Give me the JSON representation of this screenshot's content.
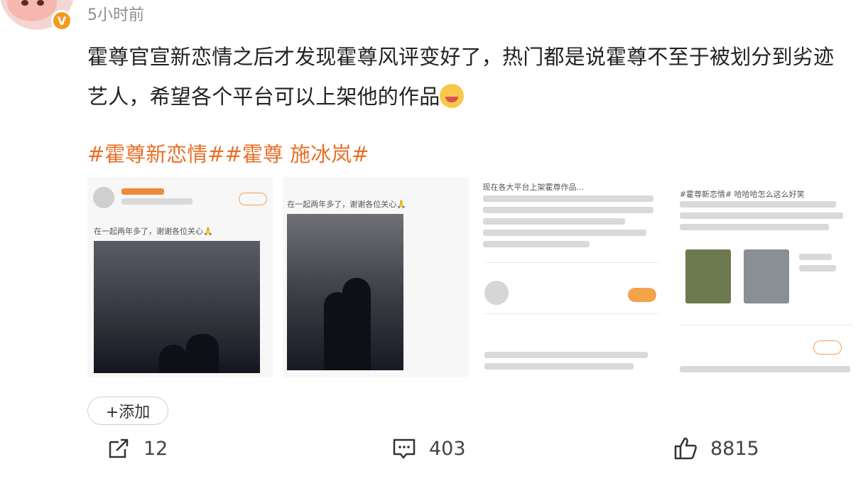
{
  "post": {
    "time": "5小时前",
    "text_line1": "霍尊官宣新恋情之后才发现霍尊风评变好了，热门都是说霍尊不至于被划分到劣迹",
    "text_line2": "艺人，希望各个平台可以上架他的作品",
    "hashtags": "#霍尊新恋情##霍尊 施冰岚#",
    "add_button": "+添加"
  },
  "thumbnails": [
    {
      "caption": "在一起两年多了，谢谢各位关心🙏"
    },
    {
      "caption": "在一起两年多了，谢谢各位关心🙏"
    },
    {
      "caption": "现在各大平台上架霍尊作品…"
    },
    {
      "caption": "#霍尊新恋情# 哈哈哈怎么这么好笑"
    }
  ],
  "actions": {
    "repost_count": "12",
    "comment_count": "403",
    "like_count": "8815"
  },
  "colors": {
    "hashtag": "#e8702a",
    "badge": "#f59a1f"
  }
}
